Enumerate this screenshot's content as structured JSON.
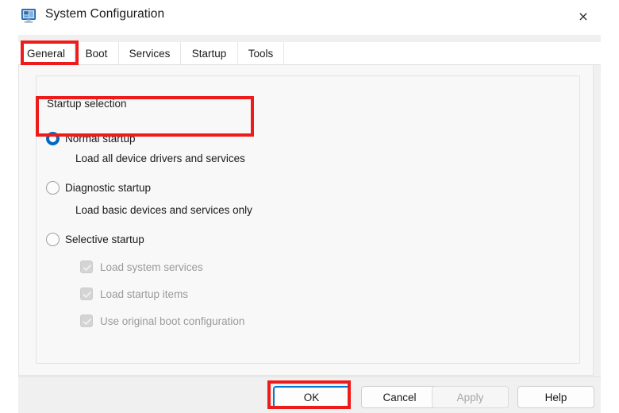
{
  "window": {
    "title": "System Configuration",
    "icon": "system-configuration-monitor-icon",
    "close_label": "×"
  },
  "tabs": [
    {
      "label": "General",
      "selected": true,
      "highlighted": true
    },
    {
      "label": "Boot",
      "selected": false,
      "highlighted": false
    },
    {
      "label": "Services",
      "selected": false,
      "highlighted": false
    },
    {
      "label": "Startup",
      "selected": false,
      "highlighted": false
    },
    {
      "label": "Tools",
      "selected": false,
      "highlighted": false
    }
  ],
  "group": {
    "legend": "Startup selection"
  },
  "options": [
    {
      "label": "Normal startup",
      "description": "Load all device drivers and services",
      "selected": true,
      "highlighted": true
    },
    {
      "label": "Diagnostic startup",
      "description": "Load basic devices and services only",
      "selected": false,
      "highlighted": false
    },
    {
      "label": "Selective startup",
      "description": "",
      "selected": false,
      "highlighted": false
    }
  ],
  "checkboxes": [
    {
      "label": "Load system services",
      "checked": true,
      "enabled": false
    },
    {
      "label": "Load startup items",
      "checked": true,
      "enabled": false
    },
    {
      "label": "Use original boot configuration",
      "checked": true,
      "enabled": false
    }
  ],
  "buttons": [
    {
      "label": "OK",
      "state": "default-focused",
      "highlighted": true
    },
    {
      "label": "Cancel",
      "state": "enabled",
      "highlighted": false
    },
    {
      "label": "Apply",
      "state": "disabled",
      "highlighted": false
    },
    {
      "label": "Help",
      "state": "enabled",
      "highlighted": false
    }
  ],
  "colors": {
    "annotation": "#ee1b1b",
    "accent": "#0078d4",
    "radio_selected": "#0069c0",
    "dialog_background": "#f0f0f0",
    "panel_background": "#f8f8f8",
    "disabled_text": "#9a9a9a"
  }
}
